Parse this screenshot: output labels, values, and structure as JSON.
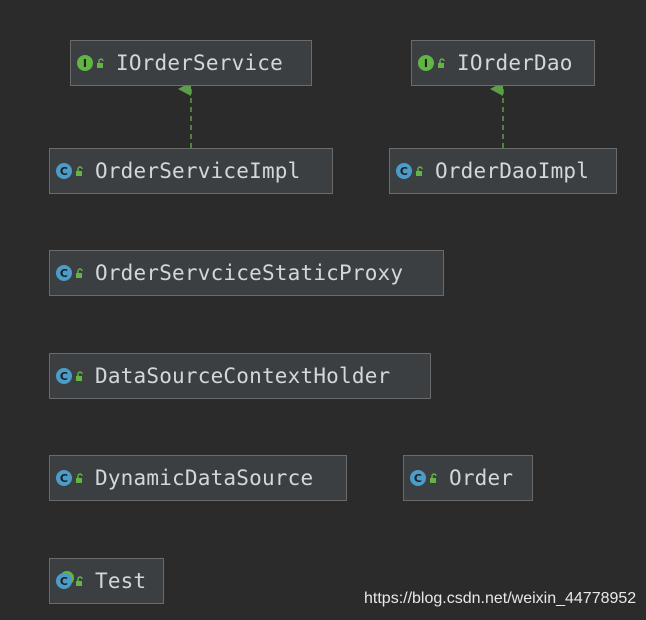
{
  "diagram": {
    "nodes": [
      {
        "id": "IOrderService",
        "name": "IOrderService",
        "kind": "interface",
        "kind_letter": "I",
        "kind_icon": "interface-icon",
        "visibility_icon": "public-open-lock-icon"
      },
      {
        "id": "IOrderDao",
        "name": "IOrderDao",
        "kind": "interface",
        "kind_letter": "I",
        "kind_icon": "interface-icon",
        "visibility_icon": "public-open-lock-icon"
      },
      {
        "id": "OrderServiceImpl",
        "name": "OrderServiceImpl",
        "kind": "class",
        "kind_letter": "C",
        "kind_icon": "class-icon",
        "visibility_icon": "public-open-lock-icon"
      },
      {
        "id": "OrderDaoImpl",
        "name": "OrderDaoImpl",
        "kind": "class",
        "kind_letter": "C",
        "kind_icon": "class-icon",
        "visibility_icon": "public-open-lock-icon"
      },
      {
        "id": "OrderServciceStaticProxy",
        "name": "OrderServciceStaticProxy",
        "kind": "class",
        "kind_letter": "C",
        "kind_icon": "class-icon",
        "visibility_icon": "public-open-lock-icon"
      },
      {
        "id": "DataSourceContextHolder",
        "name": "DataSourceContextHolder",
        "kind": "class",
        "kind_letter": "C",
        "kind_icon": "class-icon",
        "visibility_icon": "public-open-lock-icon"
      },
      {
        "id": "DynamicDataSource",
        "name": "DynamicDataSource",
        "kind": "class",
        "kind_letter": "C",
        "kind_icon": "class-icon",
        "visibility_icon": "public-open-lock-icon"
      },
      {
        "id": "Order",
        "name": "Order",
        "kind": "class",
        "kind_letter": "C",
        "kind_icon": "class-icon",
        "visibility_icon": "public-open-lock-icon"
      },
      {
        "id": "Test",
        "name": "Test",
        "kind": "class",
        "kind_letter": "C",
        "kind_icon": "runnable-class-icon",
        "visibility_icon": "public-open-lock-icon"
      }
    ],
    "edges": [
      {
        "from": "OrderServiceImpl",
        "to": "IOrderService",
        "type": "implements",
        "style": "dashed"
      },
      {
        "from": "OrderDaoImpl",
        "to": "IOrderDao",
        "type": "implements",
        "style": "dashed"
      }
    ],
    "colors": {
      "background": "#2b2b2b",
      "node_fill": "#3c3f41",
      "node_border": "#6b6b6b",
      "text": "#d4d7d9",
      "interface_badge": "#62b543",
      "class_badge": "#4b9cc9",
      "edge": "#5c9e4a"
    }
  },
  "watermark": "https://blog.csdn.net/weixin_44778952"
}
